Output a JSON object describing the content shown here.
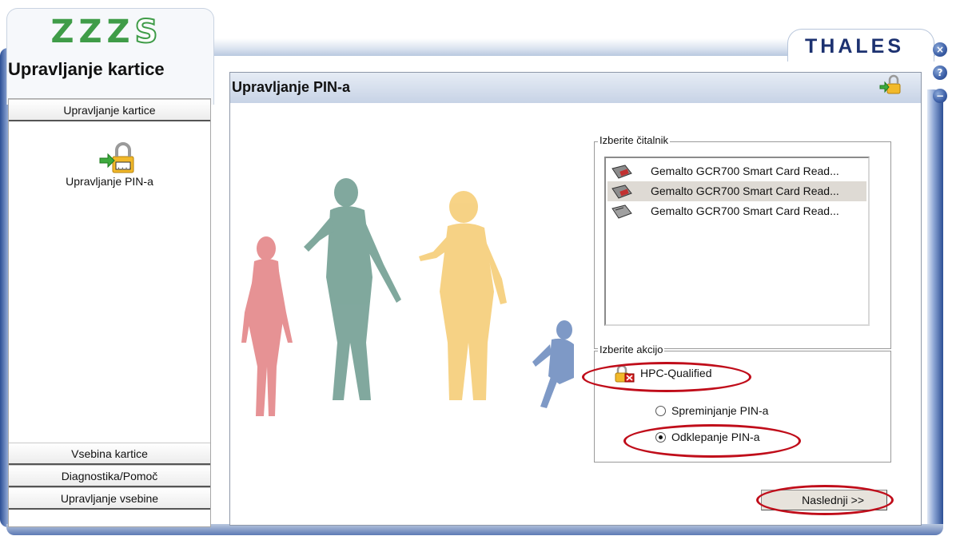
{
  "brand": {
    "logo_text": "ZZZS",
    "app_title": "Upravljanje kartice",
    "vendor": "THALES"
  },
  "window_controls": [
    {
      "name": "close",
      "glyph": "×"
    },
    {
      "name": "help",
      "glyph": "?"
    },
    {
      "name": "minimize",
      "glyph": "−"
    }
  ],
  "sidebar": {
    "top_item": "Upravljanje kartice",
    "tool_label": "Upravljanje PIN-a",
    "bottom_items": [
      "Vsebina kartice",
      "Diagnostika/Pomoč",
      "Upravljanje vsebine"
    ]
  },
  "main": {
    "title": "Upravljanje PIN-a",
    "reader_group": {
      "legend": "Izberite čitalnik",
      "readers": [
        {
          "label": "Gemalto GCR700 Smart Card Read...",
          "icon": "card-reader-icon",
          "selected": false
        },
        {
          "label": "Gemalto GCR700 Smart Card Read...",
          "icon": "card-reader-icon",
          "selected": true
        },
        {
          "label": "Gemalto GCR700 Smart Card Read...",
          "icon": "card-reader-icon",
          "selected": false
        }
      ]
    },
    "action_group": {
      "legend": "Izberite akcijo",
      "card_label": "HPC-Qualified",
      "options": [
        {
          "label": "Spreminjanje PIN-a",
          "checked": false
        },
        {
          "label": "Odklepanje PIN-a",
          "checked": true
        }
      ]
    },
    "next_button": "Naslednji >>"
  },
  "colors": {
    "brand_blue": "#1c3170",
    "logo_green": "#3f9c48",
    "highlight_red": "#c00d1a"
  }
}
